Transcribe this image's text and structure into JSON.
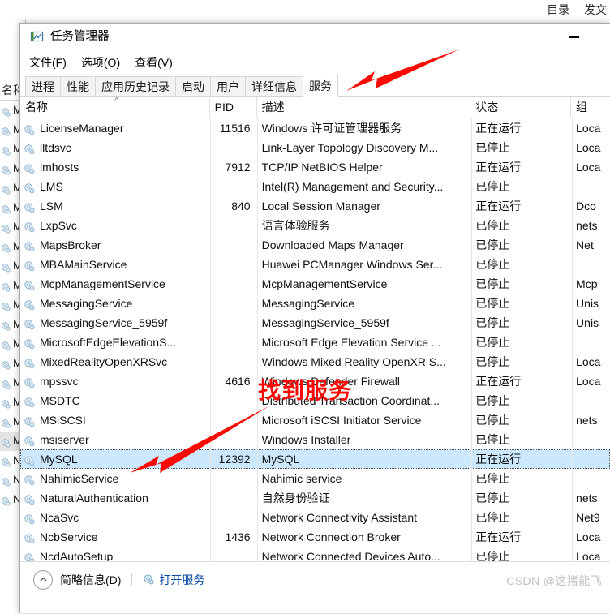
{
  "browser": {
    "links": [
      "目录",
      "发文"
    ]
  },
  "background_window": {
    "header": "名称",
    "rows": [
      {
        "label": "Mic",
        "selected": false
      },
      {
        "label": "Mic",
        "selected": false
      },
      {
        "label": "Mic",
        "selected": false
      },
      {
        "label": "Mic",
        "selected": false
      },
      {
        "label": "Mic",
        "selected": false
      },
      {
        "label": "Mic",
        "selected": false
      },
      {
        "label": "Mic",
        "selected": false
      },
      {
        "label": "Mic",
        "selected": false
      },
      {
        "label": "Mic",
        "selected": false
      },
      {
        "label": "Mic",
        "selected": false
      },
      {
        "label": "Mic",
        "selected": false
      },
      {
        "label": "Mic",
        "selected": false
      },
      {
        "label": "Mic",
        "selected": false
      },
      {
        "label": "Mic",
        "selected": false
      },
      {
        "label": "Mic",
        "selected": false
      },
      {
        "label": "Mic",
        "selected": false
      },
      {
        "label": "Mic",
        "selected": false
      },
      {
        "label": "My",
        "selected": true
      },
      {
        "label": "Nal",
        "selected": false
      },
      {
        "label": "Net",
        "selected": false
      },
      {
        "label": "Net",
        "selected": false
      }
    ]
  },
  "task_manager": {
    "title": "任务管理器",
    "icon": "chart-window-icon",
    "minimize_label": "—",
    "menus": [
      "文件(F)",
      "选项(O)",
      "查看(V)"
    ],
    "tabs": [
      {
        "label": "进程",
        "active": false
      },
      {
        "label": "性能",
        "active": false
      },
      {
        "label": "应用历史记录",
        "active": false
      },
      {
        "label": "启动",
        "active": false
      },
      {
        "label": "用户",
        "active": false
      },
      {
        "label": "详细信息",
        "active": false
      },
      {
        "label": "服务",
        "active": true
      }
    ],
    "columns": [
      {
        "key": "name",
        "label": "名称",
        "sort": "^"
      },
      {
        "key": "pid",
        "label": "PID"
      },
      {
        "key": "desc",
        "label": "描述"
      },
      {
        "key": "status",
        "label": "状态"
      },
      {
        "key": "group",
        "label": "组"
      }
    ],
    "rows": [
      {
        "name": "LicenseManager",
        "pid": "11516",
        "desc": "Windows 许可证管理器服务",
        "status": "正在运行",
        "group": "Loca",
        "selected": false
      },
      {
        "name": "lltdsvc",
        "pid": "",
        "desc": "Link-Layer Topology Discovery M...",
        "status": "已停止",
        "group": "Loca",
        "selected": false
      },
      {
        "name": "lmhosts",
        "pid": "7912",
        "desc": "TCP/IP NetBIOS Helper",
        "status": "正在运行",
        "group": "Loca",
        "selected": false
      },
      {
        "name": "LMS",
        "pid": "",
        "desc": "Intel(R) Management and Security...",
        "status": "已停止",
        "group": "",
        "selected": false
      },
      {
        "name": "LSM",
        "pid": "840",
        "desc": "Local Session Manager",
        "status": "正在运行",
        "group": "Dco",
        "selected": false
      },
      {
        "name": "LxpSvc",
        "pid": "",
        "desc": "语言体验服务",
        "status": "已停止",
        "group": "nets",
        "selected": false
      },
      {
        "name": "MapsBroker",
        "pid": "",
        "desc": "Downloaded Maps Manager",
        "status": "已停止",
        "group": "Net",
        "selected": false
      },
      {
        "name": "MBAMainService",
        "pid": "",
        "desc": "Huawei PCManager Windows Ser...",
        "status": "已停止",
        "group": "",
        "selected": false
      },
      {
        "name": "McpManagementService",
        "pid": "",
        "desc": "McpManagementService",
        "status": "已停止",
        "group": "Mcp",
        "selected": false
      },
      {
        "name": "MessagingService",
        "pid": "",
        "desc": "MessagingService",
        "status": "已停止",
        "group": "Unis",
        "selected": false
      },
      {
        "name": "MessagingService_5959f",
        "pid": "",
        "desc": "MessagingService_5959f",
        "status": "已停止",
        "group": "Unis",
        "selected": false
      },
      {
        "name": "MicrosoftEdgeElevationS...",
        "pid": "",
        "desc": "Microsoft Edge Elevation Service ...",
        "status": "已停止",
        "group": "",
        "selected": false
      },
      {
        "name": "MixedRealityOpenXRSvc",
        "pid": "",
        "desc": "Windows Mixed Reality OpenXR S...",
        "status": "已停止",
        "group": "Loca",
        "selected": false
      },
      {
        "name": "mpssvc",
        "pid": "4616",
        "desc": "Windows Defender Firewall",
        "status": "正在运行",
        "group": "Loca",
        "selected": false
      },
      {
        "name": "MSDTC",
        "pid": "",
        "desc": "Distributed Transaction Coordinat...",
        "status": "已停止",
        "group": "",
        "selected": false
      },
      {
        "name": "MSiSCSI",
        "pid": "",
        "desc": "Microsoft iSCSI Initiator Service",
        "status": "已停止",
        "group": "nets",
        "selected": false
      },
      {
        "name": "msiserver",
        "pid": "",
        "desc": "Windows Installer",
        "status": "已停止",
        "group": "",
        "selected": false
      },
      {
        "name": "MySQL",
        "pid": "12392",
        "desc": "MySQL",
        "status": "正在运行",
        "group": "",
        "selected": true
      },
      {
        "name": "NahimicService",
        "pid": "",
        "desc": "Nahimic service",
        "status": "已停止",
        "group": "",
        "selected": false
      },
      {
        "name": "NaturalAuthentication",
        "pid": "",
        "desc": "自然身份验证",
        "status": "已停止",
        "group": "nets",
        "selected": false
      },
      {
        "name": "NcaSvc",
        "pid": "",
        "desc": "Network Connectivity Assistant",
        "status": "已停止",
        "group": "Net9",
        "selected": false
      },
      {
        "name": "NcbService",
        "pid": "1436",
        "desc": "Network Connection Broker",
        "status": "正在运行",
        "group": "Loca",
        "selected": false
      },
      {
        "name": "NcdAutoSetup",
        "pid": "",
        "desc": "Network Connected Devices Auto...",
        "status": "已停止",
        "group": "Loca",
        "selected": false
      }
    ],
    "statusbar": {
      "collapse_label": "简略信息(D)",
      "open_services_label": "打开服务"
    }
  },
  "annotations": {
    "text": "找到服务",
    "arrow_color": "#fb0a05"
  },
  "watermark": "CSDN @这猪能飞"
}
